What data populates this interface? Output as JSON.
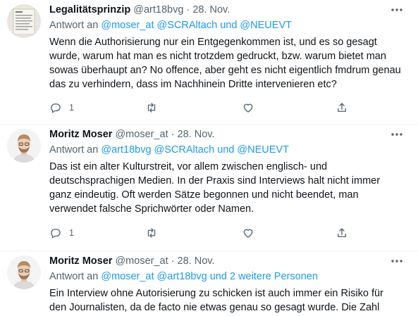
{
  "tweets": [
    {
      "name": "Legalitätsprinzip",
      "handle": "@art18bvg",
      "sep": "·",
      "date": "28. Nov.",
      "reply_prefix": "Antwort an",
      "reply_to": "@moser_at @SCRAltach und @NEUEVT",
      "text": "Wenn die Authorisierung nur ein Entgegenkommen ist, und es so gesagt wurde, warum hat man es nicht trotzdem gedruckt, bzw. warum bietet man sowas überhaupt an? No offence, aber geht es nicht eigentlich fmdrum genau das zu verhindern, dass im Nachhinein Dritte intervenieren etc?",
      "reply_count": "1"
    },
    {
      "name": "Moritz Moser",
      "handle": "@moser_at",
      "sep": "·",
      "date": "28. Nov.",
      "reply_prefix": "Antwort an",
      "reply_to": "@art18bvg @SCRAltach und @NEUEVT",
      "text": "Das ist ein alter Kulturstreit, vor allem zwischen englisch- und deutschsprachigen Medien. In der Praxis sind Interviews halt nicht immer ganz eindeutig. Oft werden Sätze begonnen und nicht beendet, man verwendet falsche Sprichwörter oder Namen.",
      "reply_count": "1"
    },
    {
      "name": "Moritz Moser",
      "handle": "@moser_at",
      "sep": "·",
      "date": "28. Nov.",
      "reply_prefix": "Antwort an",
      "reply_to": "@moser_at @art18bvg und 2 weitere Personen",
      "text": "Ein Interview ohne Autorisierung zu schicken ist auch immer ein Risiko für den Journalisten, da de facto nie etwas genau so gesagt wurde. Die Zahl"
    }
  ],
  "icons": [
    "more-icon",
    "reply-icon",
    "retweet-icon",
    "like-icon",
    "share-icon"
  ],
  "colors": {
    "link": "#1d9bf0",
    "muted": "#536471",
    "text": "#0f1419"
  }
}
